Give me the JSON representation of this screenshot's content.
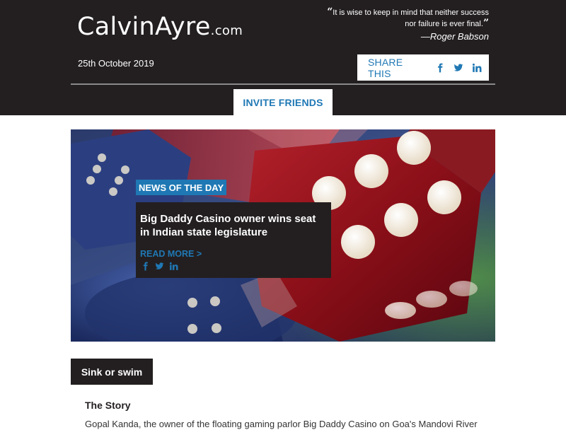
{
  "header": {
    "logo_main": "CalvinAyre",
    "logo_suffix": ".com",
    "quote_open": "“",
    "quote_text": "It is wise to keep in mind that neither success nor failure is ever final.",
    "quote_close": "”",
    "quote_author": "—Roger Babson",
    "date": "25th October 2019",
    "share_label": "SHARE THIS",
    "share_icons": [
      "facebook-icon",
      "twitter-icon",
      "linkedin-icon"
    ],
    "invite_label": "INVITE FRIENDS"
  },
  "hero": {
    "badge": "NEWS OF THE DAY",
    "title": "Big Daddy Casino owner wins seat in Indian state legislature",
    "read_more": "READ MORE >",
    "share_icons": [
      "facebook-icon",
      "twitter-icon",
      "linkedin-icon"
    ]
  },
  "section": {
    "tab_label": "Sink or swim",
    "story_heading": "The Story",
    "story_snippet": "Gopal Kanda, the owner of the floating gaming parlor Big Daddy Casino on Goa's Mandovi River"
  },
  "colors": {
    "header_bg": "#231f20",
    "accent_blue": "#1f78b4",
    "white": "#ffffff"
  }
}
